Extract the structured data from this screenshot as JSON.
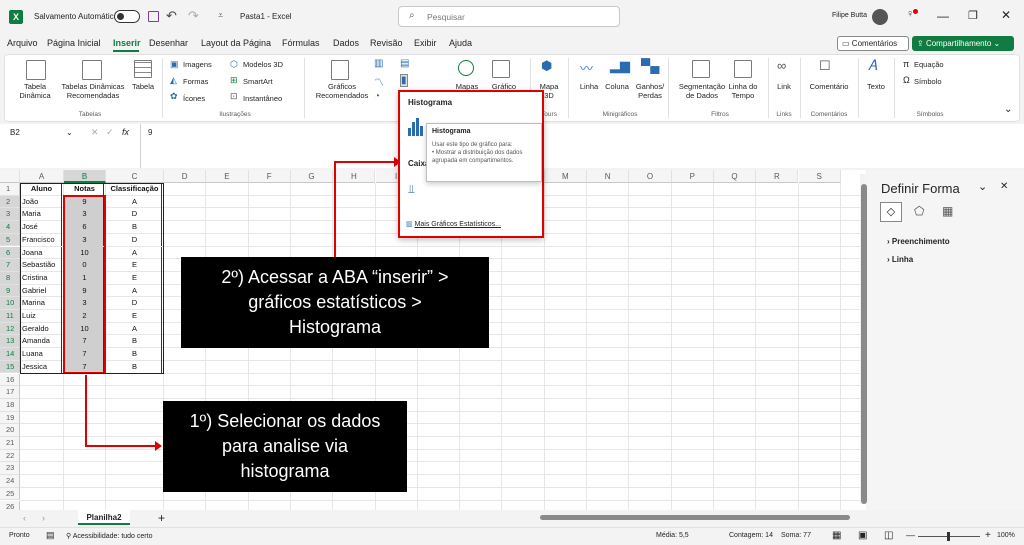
{
  "titlebar": {
    "autosave_label": "Salvamento Automático",
    "toggle_state": "Off",
    "doc_title": "Pasta1 - Excel",
    "search_placeholder": "Pesquisar",
    "user_name": "Filipe Butta"
  },
  "menu": [
    "Arquivo",
    "Página Inicial",
    "Inserir",
    "Desenhar",
    "Layout da Página",
    "Fórmulas",
    "Dados",
    "Revisão",
    "Exibir",
    "Ajuda"
  ],
  "menu_active": "Inserir",
  "menu_right": {
    "comments": "Comentários",
    "share": "Compartilhamento"
  },
  "ribbon": {
    "tabela_dinamica": "Tabela\nDinâmica",
    "tabelas_recomendadas": "Tabelas Dinâmicas\nRecomendadas",
    "tabela": "Tabela",
    "group_tabelas": "Tabelas",
    "imagens": "Imagens",
    "formas": "Formas",
    "icones": "Ícones",
    "modelos3d": "Modelos 3D",
    "smartart": "SmartArt",
    "instantaneo": "Instantâneo",
    "group_ilustracoes": "Ilustrações",
    "graficos_recomendados": "Gráficos\nRecomendados",
    "mapas": "Mapas",
    "grafico_din": "Gráfico",
    "mapa3d": "Mapa\n3D",
    "tours": "Tours",
    "linha": "Linha",
    "coluna": "Coluna",
    "ganhos_perdas": "Ganhos/\nPerdas",
    "group_minigraficos": "Minigráficos",
    "segmentacao": "Segmentação\nde Dados",
    "linha_tempo": "Linha do\nTempo",
    "group_filtros": "Filtros",
    "link": "Link",
    "group_links": "Links",
    "comentario": "Comentário",
    "group_comentarios": "Comentários",
    "texto": "Texto",
    "equacao": "Equação",
    "simbolo": "Símbolo",
    "group_simbolos": "Símbolos"
  },
  "dropdown": {
    "header": "Histograma",
    "section2": "Caixa",
    "more": "Mais Gráficos Estatísticos..."
  },
  "tooltip": {
    "title": "Histograma",
    "body": "Usar este tipo de gráfico para:\n• Mostrar a distribuição dos dados agrupada em compartimentos."
  },
  "formula_bar": {
    "name_box": "B2",
    "fx": "fx",
    "value": "9"
  },
  "columns": [
    "A",
    "B",
    "C",
    "D",
    "E",
    "F",
    "G",
    "H",
    "I",
    "J",
    "K",
    "L",
    "M",
    "N",
    "O",
    "P",
    "Q",
    "R",
    "S"
  ],
  "rows": [
    "1",
    "2",
    "3",
    "4",
    "5",
    "6",
    "7",
    "8",
    "9",
    "10",
    "11",
    "12",
    "13",
    "14",
    "15",
    "16",
    "17",
    "18",
    "19",
    "20",
    "21",
    "22",
    "23",
    "24",
    "25",
    "26"
  ],
  "table": {
    "headers": [
      "Aluno",
      "Notas",
      "Classificação"
    ],
    "data": [
      [
        "João",
        "9",
        "A"
      ],
      [
        "Maria",
        "3",
        "D"
      ],
      [
        "José",
        "6",
        "B"
      ],
      [
        "Francisco",
        "3",
        "D"
      ],
      [
        "Joana",
        "10",
        "A"
      ],
      [
        "Sebastião",
        "0",
        "E"
      ],
      [
        "Cristina",
        "1",
        "E"
      ],
      [
        "Gabriel",
        "9",
        "A"
      ],
      [
        "Marina",
        "3",
        "D"
      ],
      [
        "Luiz",
        "2",
        "E"
      ],
      [
        "Geraldo",
        "10",
        "A"
      ],
      [
        "Amanda",
        "7",
        "B"
      ],
      [
        "Luana",
        "7",
        "B"
      ],
      [
        "Jessica",
        "7",
        "B"
      ]
    ]
  },
  "callouts": {
    "step2": [
      "2º) Acessar a ABA “inserir” >",
      "gráficos estatísticos >",
      "Histograma"
    ],
    "step1": [
      "1º) Selecionar os dados",
      "para analise via",
      "histograma"
    ]
  },
  "side_panel": {
    "title": "Definir Forma",
    "fill": "Preenchimento",
    "line": "Linha"
  },
  "sheet": {
    "tab": "Planilha2"
  },
  "status": {
    "ready": "Pronto",
    "accessibility": "Acessibilidade: tudo certo",
    "average": "Média: 5,5",
    "count": "Contagem: 14",
    "sum": "Soma: 77",
    "zoom": "100%"
  },
  "colors": {
    "excel_green": "#107c41",
    "highlight_red": "#e00000",
    "select_fill": "#c6c6c6",
    "header_sel": "#d6d6d6"
  }
}
